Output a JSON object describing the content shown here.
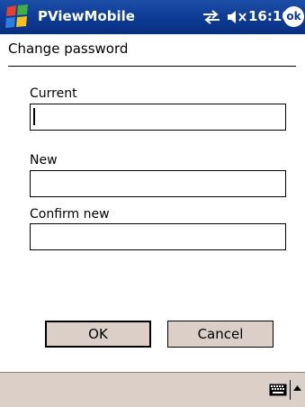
{
  "titlebar": {
    "app_title": "PViewMobile",
    "clock": "16:10",
    "ok_label": "ok",
    "icons": [
      "start-flag",
      "connectivity",
      "volume-muted"
    ],
    "bg_color": "#0c3a94"
  },
  "page": {
    "heading": "Change password"
  },
  "form": {
    "current_label": "Current",
    "current_value": "",
    "new_label": "New",
    "new_value": "",
    "confirm_label": "Confirm new",
    "confirm_value": ""
  },
  "buttons": {
    "ok_label": "OK",
    "cancel_label": "Cancel"
  },
  "bottombar": {
    "icons": [
      "keyboard",
      "sip-menu-arrow"
    ],
    "bg_color": "#dbcfc7"
  }
}
